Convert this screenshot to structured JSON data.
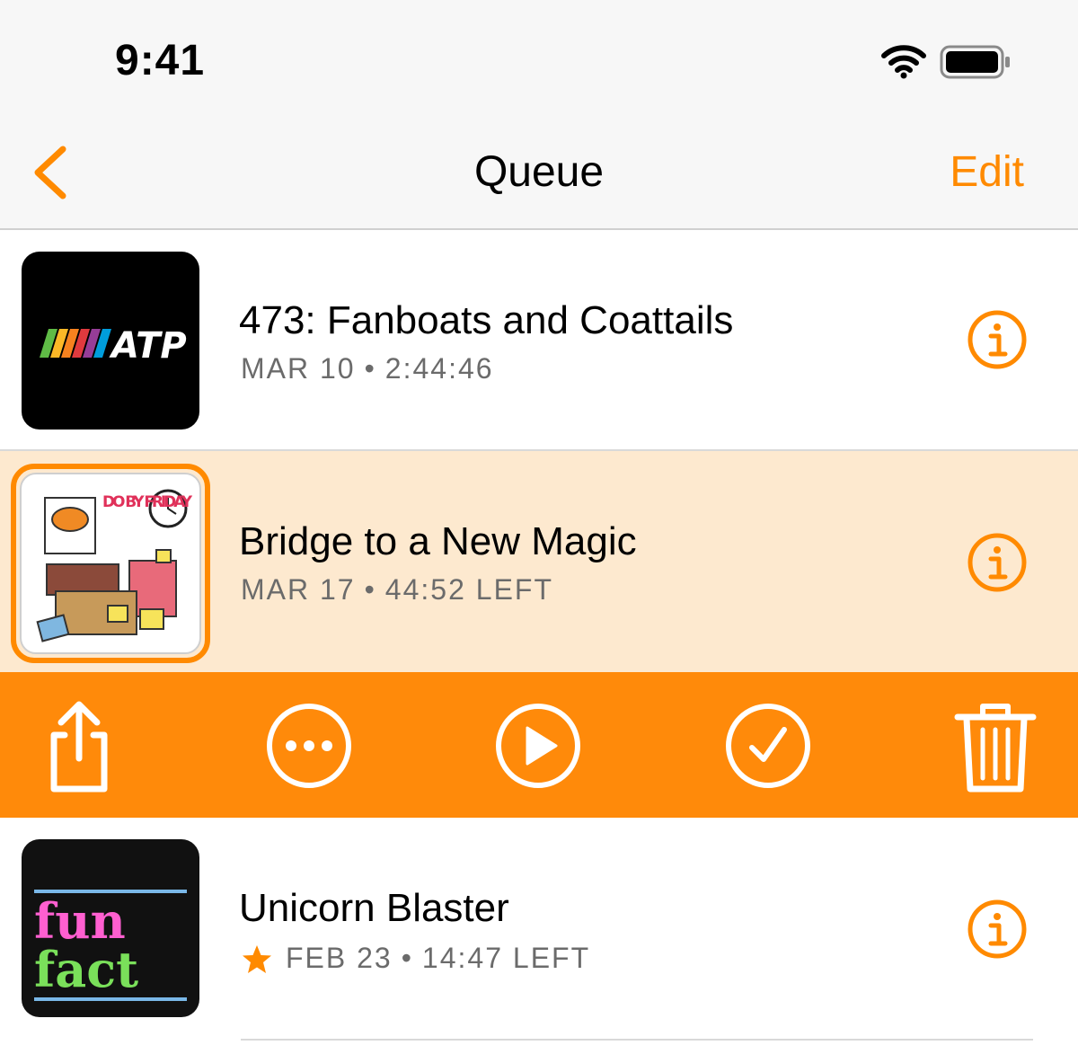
{
  "status": {
    "time": "9:41"
  },
  "nav": {
    "title": "Queue",
    "edit_label": "Edit"
  },
  "episodes": [
    {
      "title": "473: Fanboats and Coattails",
      "date": "MAR 10",
      "duration": "2:44:46",
      "artwork_text": "ATP"
    },
    {
      "title": "Bridge to a New Magic",
      "date": "MAR 17",
      "duration": "44:52 LEFT",
      "artwork_text": "DO BY FRIDAY"
    },
    {
      "title": "Unicorn Blaster",
      "date": "FEB 23",
      "duration": "14:47 LEFT",
      "artwork_text_1": "fun",
      "artwork_text_2": "fact",
      "starred": true
    }
  ],
  "actions": [
    {
      "name": "share",
      "icon": "share-icon"
    },
    {
      "name": "more",
      "icon": "ellipsis-circle-icon"
    },
    {
      "name": "play",
      "icon": "play-circle-icon"
    },
    {
      "name": "mark-played",
      "icon": "checkmark-circle-icon"
    },
    {
      "name": "delete",
      "icon": "trash-icon"
    }
  ],
  "colors": {
    "accent": "#ff8a00",
    "highlight_row": "#fde9cf",
    "action_bar": "#ff8a0a"
  }
}
